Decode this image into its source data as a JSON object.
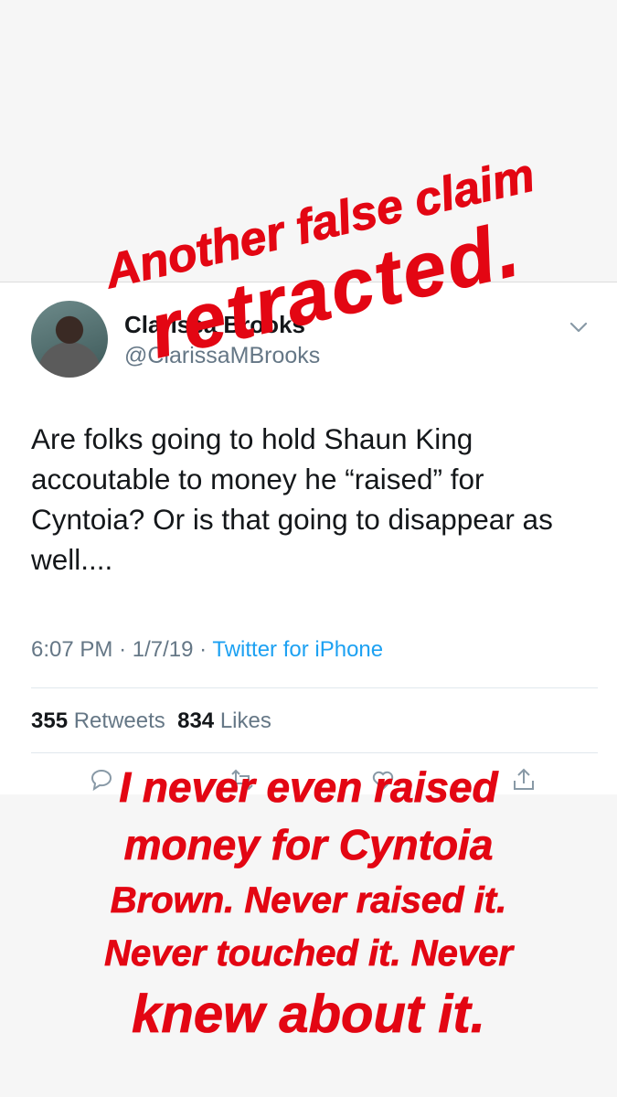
{
  "tweet": {
    "author_name": "Clarissa Brooks",
    "author_handle": "@ClarissaMBrooks",
    "text": "Are folks going to hold Shaun King accoutable to money he “raised” for Cyntoia? Or is that going to disappear as well....",
    "time": "6:07 PM",
    "date": "1/7/19",
    "separator": "·",
    "source": "Twitter for iPhone",
    "retweets_count": "355",
    "retweets_label": "Retweets",
    "likes_count": "834",
    "likes_label": "Likes",
    "source_color": "#1da1f2"
  },
  "stickers": {
    "top_line1": "Another false claim",
    "top_line2": "retracted.",
    "bottom_line1": "I never even raised",
    "bottom_line2": "money for Cyntoia",
    "bottom_line3": "Brown. Never raised it.",
    "bottom_line4": "Never touched it. Never",
    "bottom_line5": "knew about it.",
    "color": "#e30613"
  },
  "icons": [
    "chevron-down-icon",
    "reply-icon",
    "retweet-icon",
    "like-icon",
    "share-icon"
  ]
}
